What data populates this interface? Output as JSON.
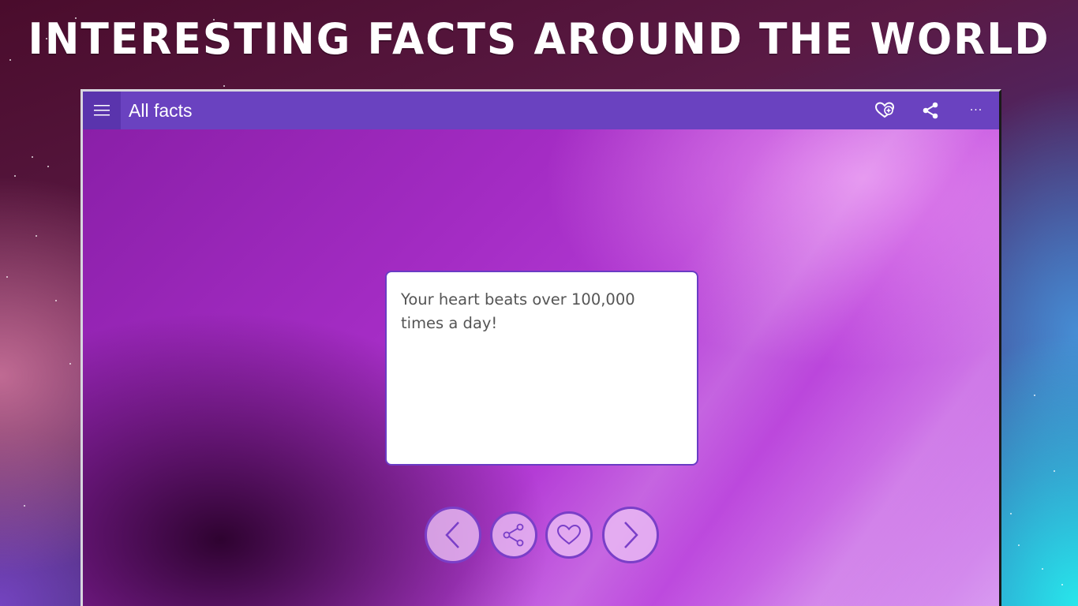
{
  "banner": {
    "headline": "Interesting facts around the world"
  },
  "app": {
    "title": "All facts",
    "toolbar": {
      "menu_icon": "hamburger-menu-icon",
      "favorites_icon": "heart-plus-icon",
      "share_icon": "share-icon",
      "more_label": "···"
    }
  },
  "fact": {
    "text": "Your heart beats over 100,000 times a day!"
  },
  "controls": {
    "previous_icon": "chevron-left-icon",
    "share_icon": "share-icon",
    "favorite_icon": "heart-icon",
    "next_icon": "chevron-right-icon"
  },
  "colors": {
    "titlebar": "#6a42c0",
    "accent": "#7a3fc8",
    "card_background": "#ffffff"
  }
}
